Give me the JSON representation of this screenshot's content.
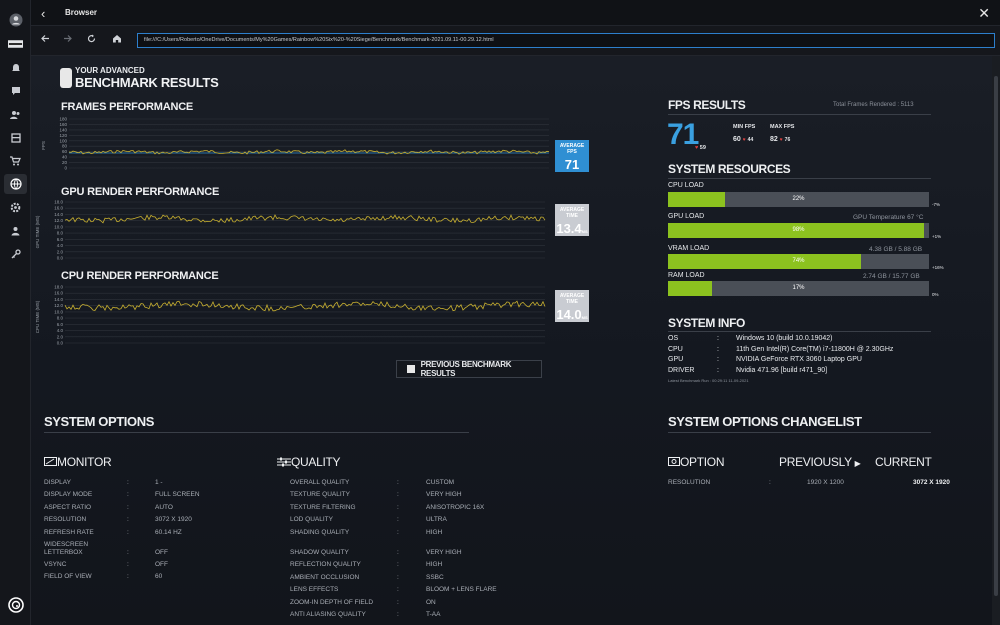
{
  "window": {
    "title": "Browser",
    "back": "‹",
    "close": "✕"
  },
  "nav": {
    "url": "file:///C:/Users/Roberto/OneDrive/Documents/My%20Games/Rainbow%20Six%20-%20Siege/Benchmark/Benchmark-2021.09.11-00.29.12.html"
  },
  "header": {
    "line1": "YOUR ADVANCED",
    "line2": "BENCHMARK RESULTS"
  },
  "frames": {
    "title": "FRAMES PERFORMANCE",
    "ylabel": "FPS",
    "avg_label": "AVERAGE FPS",
    "avg_value": "71",
    "ticks": [
      "180",
      "160",
      "140",
      "120",
      "100",
      "80",
      "60",
      "40",
      "20",
      "0"
    ]
  },
  "gpu": {
    "title": "GPU RENDER PERFORMANCE",
    "ylabel": "GPU TIME (MS)",
    "avg_label": "AVERAGE TIME",
    "avg_value": "13.4",
    "unit": "MS",
    "ticks": [
      "18.0",
      "16.0",
      "14.0",
      "12.0",
      "10.0",
      "8.0",
      "6.0",
      "4.0",
      "2.0",
      "0.0"
    ]
  },
  "cpu": {
    "title": "CPU RENDER PERFORMANCE",
    "ylabel": "CPU TIME (MS)",
    "avg_label": "AVERAGE TIME",
    "avg_value": "14.0",
    "unit": "MS",
    "ticks": [
      "18.0",
      "16.0",
      "14.0",
      "12.0",
      "10.0",
      "8.0",
      "6.0",
      "4.0",
      "2.0",
      "0.0"
    ]
  },
  "prev_button": "PREVIOUS BENCHMARK RESULTS",
  "fps_results": {
    "title": "FPS RESULTS",
    "total_frames": "Total Frames Rendered : 5113",
    "avg": "71",
    "avg_sub": "59",
    "min_label": "MIN FPS",
    "min_value": "60",
    "min_sub": "44",
    "max_label": "MAX FPS",
    "max_value": "82",
    "max_sub": "76"
  },
  "system_resources": {
    "title": "SYSTEM RESOURCES",
    "cpu": {
      "label": "CPU LOAD",
      "pct": "22%",
      "fill": 0.22,
      "delta": "-7%",
      "right": ""
    },
    "gpu": {
      "label": "GPU LOAD",
      "pct": "98%",
      "fill": 0.98,
      "delta": "+1%",
      "right": "GPU Temperature 67 °C"
    },
    "vram": {
      "label": "VRAM LOAD",
      "pct": "74%",
      "fill": 0.74,
      "delta": "+16%",
      "right": "4.38 GB / 5.88 GB"
    },
    "ram": {
      "label": "RAM LOAD",
      "pct": "17%",
      "fill": 0.17,
      "delta": "0%",
      "right": "2.74 GB / 15.77 GB"
    }
  },
  "system_info": {
    "title": "SYSTEM INFO",
    "rows": [
      {
        "k": "OS",
        "v": "Windows 10 (build 10.0.19042)"
      },
      {
        "k": "CPU",
        "v": "11th Gen Intel(R) Core(TM) i7-11800H @ 2.30GHz"
      },
      {
        "k": "GPU",
        "v": "NVIDIA GeForce RTX 3060 Laptop GPU"
      },
      {
        "k": "DRIVER",
        "v": "Nvidia 471.96 [build r471_90]"
      }
    ],
    "latest": "Latest Benchmark Run : 00:29:11 11-09-2021"
  },
  "system_options": {
    "title": "SYSTEM OPTIONS",
    "monitor": {
      "title": "MONITOR",
      "rows": [
        {
          "k": "DISPLAY",
          "v": "1 -"
        },
        {
          "k": "DISPLAY MODE",
          "v": "FULL SCREEN"
        },
        {
          "k": "ASPECT RATIO",
          "v": "AUTO"
        },
        {
          "k": "RESOLUTION",
          "v": "3072 X 1920"
        },
        {
          "k": "REFRESH RATE",
          "v": "60.14 HZ"
        },
        {
          "k": "WIDESCREEN LETTERBOX",
          "v": "OFF"
        },
        {
          "k": "VSYNC",
          "v": "OFF"
        },
        {
          "k": "FIELD OF VIEW",
          "v": "60"
        }
      ]
    },
    "quality": {
      "title": "QUALITY",
      "rows": [
        {
          "k": "OVERALL QUALITY",
          "v": "CUSTOM"
        },
        {
          "k": "TEXTURE QUALITY",
          "v": "VERY HIGH"
        },
        {
          "k": "TEXTURE FILTERING",
          "v": "ANISOTROPIC 16X"
        },
        {
          "k": "LOD QUALITY",
          "v": "ULTRA"
        },
        {
          "k": "SHADING QUALITY",
          "v": "HIGH"
        },
        {
          "k": "SHADOW QUALITY",
          "v": "VERY HIGH"
        },
        {
          "k": "REFLECTION QUALITY",
          "v": "HIGH"
        },
        {
          "k": "AMBIENT OCCLUSION",
          "v": "SSBC"
        },
        {
          "k": "LENS EFFECTS",
          "v": "BLOOM + LENS FLARE"
        },
        {
          "k": "ZOOM-IN DEPTH OF FIELD",
          "v": "ON"
        },
        {
          "k": "ANTI ALIASING QUALITY",
          "v": "T-AA"
        }
      ]
    }
  },
  "changelog": {
    "title": "SYSTEM OPTIONS CHANGELIST",
    "col_option": "OPTION",
    "col_previously": "PREVIOUSLY",
    "col_current": "CURRENT",
    "rows": [
      {
        "k": "RESOLUTION",
        "prev": "1920 X 1200",
        "cur": "3072 X 1920"
      }
    ]
  },
  "colors": {
    "accent": "#3aa0e0",
    "load": "#8cc21f",
    "bar_bg": "#4a4f57",
    "trace": "#c8b030",
    "red": "#e0413f"
  }
}
